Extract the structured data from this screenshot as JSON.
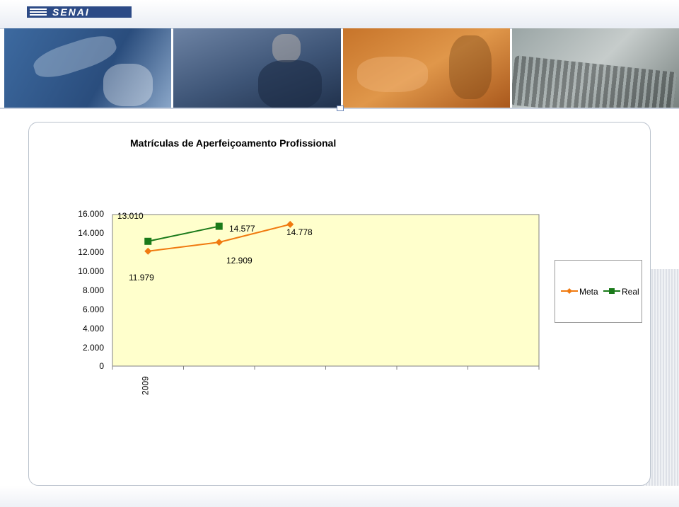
{
  "header": {
    "logo_text": "SENAI"
  },
  "banner": {
    "panels": [
      "robotic-arm-photo",
      "worker-with-helmet-photo",
      "lab-equipment-photo",
      "keyboard-hands-photo"
    ]
  },
  "colors": {
    "plot_background": "#ffffcc",
    "meta": "#f07a10",
    "real": "#1a7a1a",
    "header_blue": "#2c4a86"
  },
  "chart_data": {
    "type": "line",
    "title": "Matrículas de Aperfeiçoamento Profissional",
    "xlabel": "",
    "ylabel": "",
    "ylim": [
      0,
      16000
    ],
    "y_ticks": [
      "16.000",
      "14.000",
      "12.000",
      "10.000",
      "8.000",
      "6.000",
      "4.000",
      "2.000",
      "0"
    ],
    "y_tick_values": [
      16000,
      14000,
      12000,
      10000,
      8000,
      6000,
      4000,
      2000,
      0
    ],
    "categories": [
      "2009",
      "",
      "",
      "",
      "",
      ""
    ],
    "series": [
      {
        "name": "Meta",
        "values": [
          11979,
          12909,
          14778,
          null,
          null,
          null
        ],
        "labels": [
          "11.979",
          "12.909",
          "14.778",
          null,
          null,
          null
        ]
      },
      {
        "name": "Real",
        "values": [
          13010,
          14577,
          null,
          null,
          null,
          null
        ],
        "labels": [
          "13.010",
          "14.577",
          null,
          null,
          null,
          null
        ]
      }
    ],
    "grid": false,
    "legend_position": "right"
  }
}
